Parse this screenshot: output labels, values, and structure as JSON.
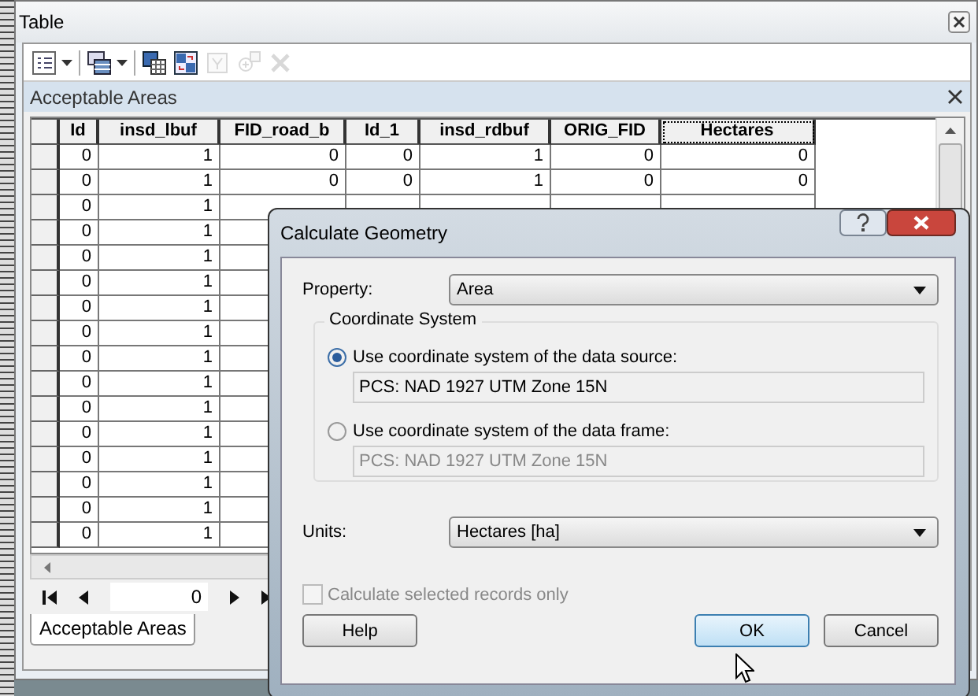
{
  "window": {
    "title": "Table"
  },
  "toolbar": {
    "items": [
      {
        "kind": "options",
        "disabled": false
      },
      {
        "kind": "related",
        "disabled": false
      },
      {
        "kind": "selectall",
        "disabled": false
      },
      {
        "kind": "switch",
        "disabled": false
      },
      {
        "kind": "clear",
        "disabled": true
      },
      {
        "kind": "zoom",
        "disabled": true
      },
      {
        "kind": "delete",
        "disabled": true
      }
    ]
  },
  "panel": {
    "title": "Acceptable Areas"
  },
  "table": {
    "columns": [
      {
        "label": "Id",
        "selected": false
      },
      {
        "label": "insd_lbuf",
        "selected": false
      },
      {
        "label": "FID_road_b",
        "selected": false
      },
      {
        "label": "Id_1",
        "selected": false
      },
      {
        "label": "insd_rdbuf",
        "selected": false
      },
      {
        "label": "ORIG_FID",
        "selected": false
      },
      {
        "label": "Hectares",
        "selected": true
      }
    ],
    "rows": [
      [
        "0",
        "1",
        "0",
        "0",
        "1",
        "0",
        "0"
      ],
      [
        "0",
        "1",
        "0",
        "0",
        "1",
        "0",
        "0"
      ],
      [
        "0",
        "1"
      ],
      [
        "0",
        "1"
      ],
      [
        "0",
        "1"
      ],
      [
        "0",
        "1"
      ],
      [
        "0",
        "1"
      ],
      [
        "0",
        "1"
      ],
      [
        "0",
        "1"
      ],
      [
        "0",
        "1"
      ],
      [
        "0",
        "1"
      ],
      [
        "0",
        "1"
      ],
      [
        "0",
        "1"
      ],
      [
        "0",
        "1"
      ],
      [
        "0",
        "1"
      ],
      [
        "0",
        "1"
      ]
    ]
  },
  "navigator": {
    "record": "0"
  },
  "tabs": [
    {
      "label": "Acceptable Areas",
      "selected": true
    }
  ],
  "dialog": {
    "title": "Calculate Geometry",
    "property": {
      "label": "Property:",
      "value": "Area"
    },
    "group": {
      "title": "Coordinate System",
      "options": [
        {
          "label": "Use coordinate system of the data source:",
          "selected": true,
          "value": "PCS: NAD 1927 UTM Zone 15N"
        },
        {
          "label": "Use coordinate system of the data frame:",
          "selected": false,
          "value": "PCS: NAD 1927 UTM Zone 15N"
        }
      ]
    },
    "units": {
      "label": "Units:",
      "value": "Hectares [ha]"
    },
    "selected_only": {
      "label": "Calculate selected records only",
      "checked": false,
      "disabled": true
    },
    "buttons": [
      {
        "label": "Help",
        "focused": false
      },
      {
        "label": "OK",
        "focused": true
      },
      {
        "label": "Cancel",
        "focused": false
      }
    ]
  }
}
